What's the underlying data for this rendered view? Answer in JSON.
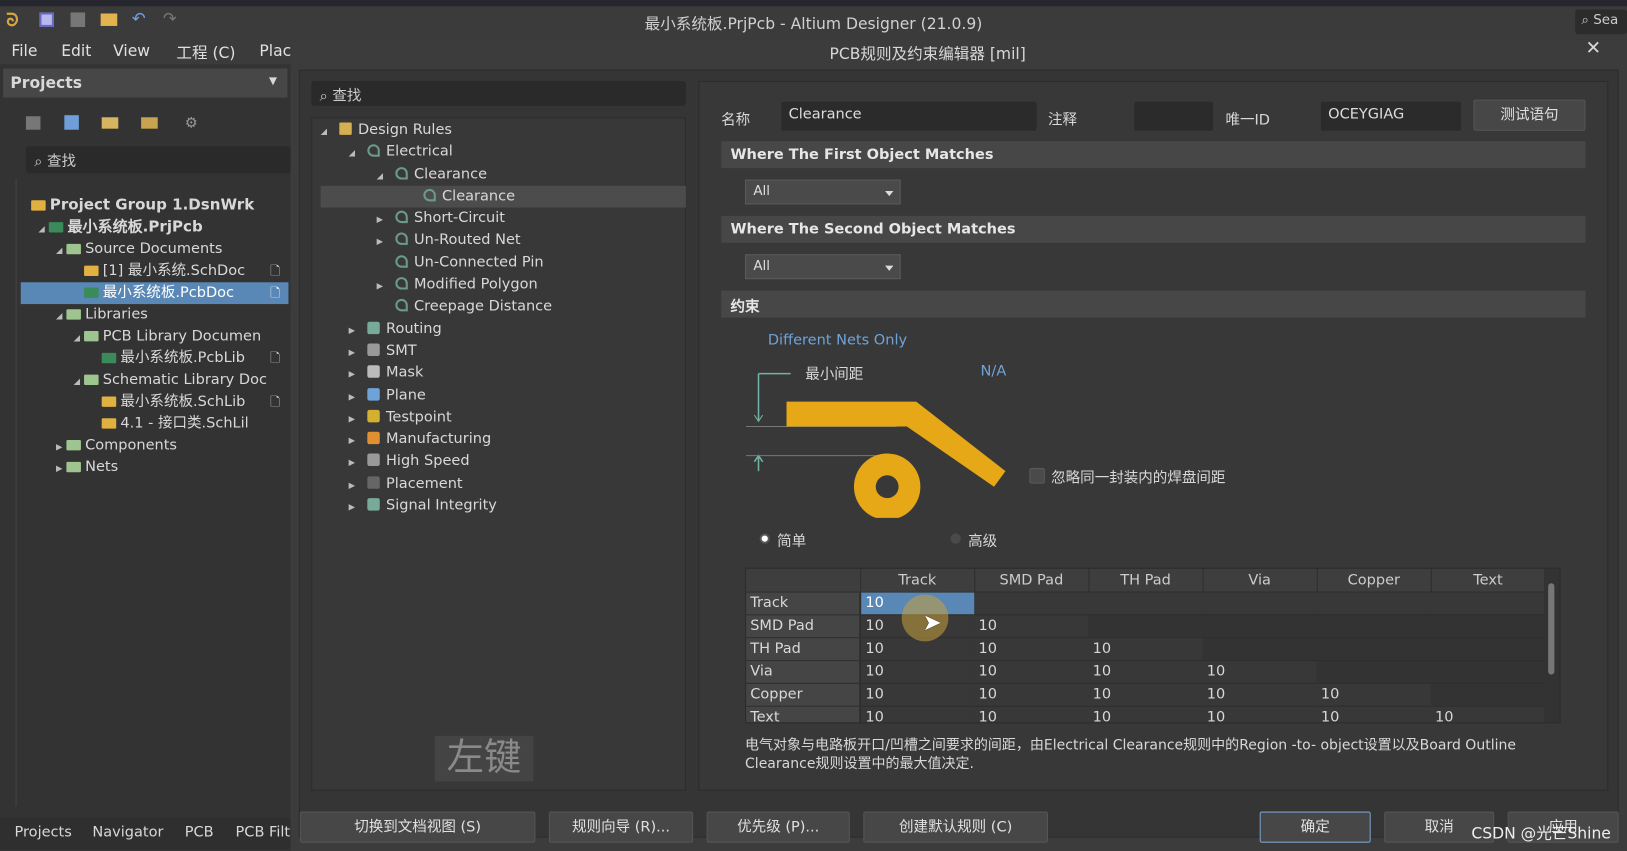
{
  "app": {
    "title": "最小系统板.PrjPcb - Altium Designer (21.0.9)",
    "search_label": "Sea"
  },
  "menu": [
    "File",
    "Edit",
    "View",
    "工程 (C)",
    "Plac"
  ],
  "projects": {
    "header": "Projects",
    "search_placeholder": "查找",
    "tree": [
      {
        "label": "Project Group 1.DsnWrk",
        "level": 0,
        "bold": true
      },
      {
        "label": "最小系统板.PrjPcb",
        "level": 1,
        "bold": true,
        "expanded": true
      },
      {
        "label": "Source Documents",
        "level": 2,
        "folder": true,
        "expanded": true
      },
      {
        "label": "[1] 最小系统.SchDoc",
        "level": 3
      },
      {
        "label": "最小系统板.PcbDoc",
        "level": 3,
        "selected": true
      },
      {
        "label": "Libraries",
        "level": 2,
        "folder": true,
        "expanded": true
      },
      {
        "label": "PCB Library Documen",
        "level": 3,
        "folder": true,
        "expanded": true
      },
      {
        "label": "最小系统板.PcbLib",
        "level": 4
      },
      {
        "label": "Schematic Library Doc",
        "level": 3,
        "folder": true,
        "expanded": true
      },
      {
        "label": "最小系统板.SchLib",
        "level": 4
      },
      {
        "label": "4.1   - 接口类.SchLil",
        "level": 4
      },
      {
        "label": "Components",
        "level": 2,
        "folder": true,
        "expanded": false
      },
      {
        "label": "Nets",
        "level": 2,
        "folder": true,
        "expanded": false
      }
    ],
    "bottom_tabs": [
      "Projects",
      "Navigator",
      "PCB",
      "PCB Filt"
    ]
  },
  "dialog": {
    "title": "PCB规则及约束编辑器 [mil]",
    "search_placeholder": "查找",
    "rules_tree": [
      {
        "label": "Design Rules",
        "level": 0,
        "expanded": true
      },
      {
        "label": "Electrical",
        "level": 1,
        "expanded": true
      },
      {
        "label": "Clearance",
        "level": 2,
        "expanded": true
      },
      {
        "label": "Clearance",
        "level": 3,
        "selected": true
      },
      {
        "label": "Short-Circuit",
        "level": 2,
        "expanded": false
      },
      {
        "label": "Un-Routed Net",
        "level": 2,
        "expanded": false
      },
      {
        "label": "Un-Connected Pin",
        "level": 2
      },
      {
        "label": "Modified Polygon",
        "level": 2,
        "expanded": false
      },
      {
        "label": "Creepage Distance",
        "level": 2
      },
      {
        "label": "Routing",
        "level": 1,
        "expanded": false
      },
      {
        "label": "SMT",
        "level": 1,
        "expanded": false
      },
      {
        "label": "Mask",
        "level": 1,
        "expanded": false
      },
      {
        "label": "Plane",
        "level": 1,
        "expanded": false
      },
      {
        "label": "Testpoint",
        "level": 1,
        "expanded": false
      },
      {
        "label": "Manufacturing",
        "level": 1,
        "expanded": false
      },
      {
        "label": "High Speed",
        "level": 1,
        "expanded": false
      },
      {
        "label": "Placement",
        "level": 1,
        "expanded": false
      },
      {
        "label": "Signal Integrity",
        "level": 1,
        "expanded": false
      }
    ],
    "overlay_text": "左键",
    "name_label": "名称",
    "name_value": "Clearance",
    "comment_label": "注释",
    "comment_value": "",
    "uid_label": "唯一ID",
    "uid_value": "OCEYGIAG",
    "test_button": "测试语句",
    "first_match": {
      "header": "Where The First Object Matches",
      "value": "All"
    },
    "second_match": {
      "header": "Where The Second Object Matches",
      "value": "All"
    },
    "constraints": {
      "header": "约束",
      "net_scope": "Different Nets Only",
      "min_clearance_label": "最小间距",
      "min_clearance_value": "N/A",
      "ignore_pads_label": "忽略同一封装内的焊盘间距",
      "ignore_pads_checked": false,
      "mode_simple": "简单",
      "mode_advanced": "高级",
      "mode_selected": "简单",
      "matrix": {
        "columns": [
          "Track",
          "SMD Pad",
          "TH Pad",
          "Via",
          "Copper",
          "Text"
        ],
        "rows": [
          {
            "label": "Track",
            "values": [
              "10"
            ]
          },
          {
            "label": "SMD Pad",
            "values": [
              "10",
              "10"
            ]
          },
          {
            "label": "TH Pad",
            "values": [
              "10",
              "10",
              "10"
            ]
          },
          {
            "label": "Via",
            "values": [
              "10",
              "10",
              "10",
              "10"
            ]
          },
          {
            "label": "Copper",
            "values": [
              "10",
              "10",
              "10",
              "10",
              "10"
            ]
          },
          {
            "label": "Text",
            "values": [
              "10",
              "10",
              "10",
              "10",
              "10",
              "10"
            ]
          }
        ]
      },
      "description": "电气对象与电路板开口/凹槽之间要求的间距，由Electrical Clearance规则中的Region -to- object设置以及Board Outline Clearance规则设置中的最大值决定."
    },
    "buttons": {
      "doc_view": "切换到文档视图 (S)",
      "wizard": "规则向导 (R)...",
      "priority": "优先级 (P)...",
      "create_default": "创建默认规则 (C)",
      "ok": "确定",
      "cancel": "取消",
      "apply": "应用"
    },
    "accent": "#5a88b6",
    "graphic_color": "#e6a817"
  },
  "watermark": "CSDN @光芒Shine"
}
